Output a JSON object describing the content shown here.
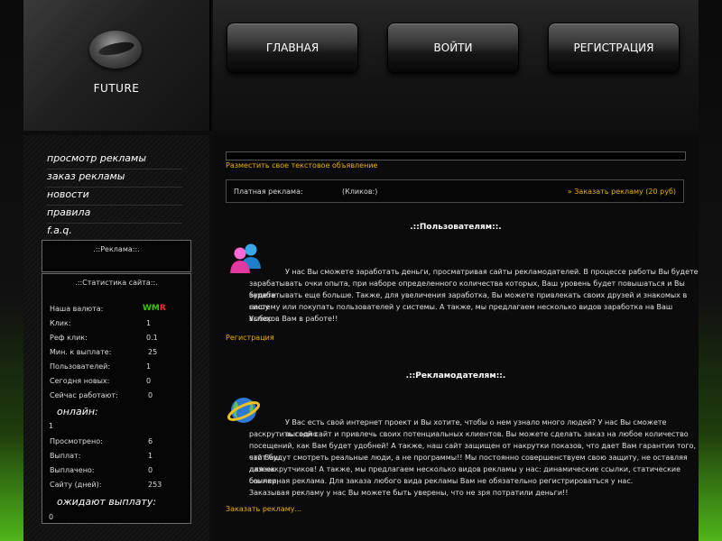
{
  "logo": {
    "text": "FUTURE"
  },
  "nav": [
    {
      "label": "ГЛАВНАЯ"
    },
    {
      "label": "ВОЙТИ"
    },
    {
      "label": "РЕГИСТРАЦИЯ"
    }
  ],
  "sidebar": {
    "menu": [
      {
        "label": "просмотр рекламы"
      },
      {
        "label": "заказ рекламы"
      },
      {
        "label": "новости"
      },
      {
        "label": "правила"
      },
      {
        "label": "f.a.q."
      }
    ],
    "ads_box": {
      "title": ".::Реклама::."
    },
    "stats": {
      "title": ".::Статистика сайта::.",
      "currency_label": "Наша валюта:",
      "currency_wm": "WM",
      "currency_r": "R",
      "rows": [
        {
          "label": "Клик:",
          "value": "1"
        },
        {
          "label": "Реф клик:",
          "value": "0.1"
        },
        {
          "label": "Мин. к выплате:",
          "value": "25"
        },
        {
          "label": "Пользователей:",
          "value": "1"
        },
        {
          "label": "Сегодня новых:",
          "value": "0"
        },
        {
          "label": "Сейчас работают:",
          "value": "0"
        }
      ],
      "online_label": "онлайн:",
      "online_value": "1",
      "rows2": [
        {
          "label": "Просмотрено:",
          "value": "6"
        },
        {
          "label": "Выплат:",
          "value": "1"
        },
        {
          "label": "Выплачено:",
          "value": "0"
        },
        {
          "label": "Сайту (дней):",
          "value": "253"
        }
      ],
      "waiting_label": "ожидают выплату:",
      "waiting_value": "0"
    }
  },
  "main": {
    "text_ad_link": "Разместить свое текстовое объявление",
    "paid_ads": {
      "label": "Платная реклама:",
      "clicks": "(Кликов:)",
      "order_link": "» Заказать рекламу (20 руб)"
    },
    "users": {
      "heading": ".::Пользователям::.",
      "lines": [
        "У нас Вы сможете заработать деньги, просматривая сайты рекламодателей. В процессе работы Вы будете",
        "зарабатывать очки опыта, при наборе определенного количества которых, Ваш уровень будет повышаться и Вы будете",
        "зарабатывать еще больше. Также, для увеличения заработка, Вы можете привлекать своих друзей и знакомых в нашу",
        "систему или покупать пользователей у системы. А также, мы предлагаем несколько видов заработка на Ваш  выбор.",
        "Успехов Вам в работе!!"
      ],
      "link": "Регистрация"
    },
    "advertisers": {
      "heading": ".::Рекламодателям::.",
      "lines": [
        "У Вас есть свой интернет проект и Вы хотите, чтобы о нем узнало много людей? У нас Вы сможете выгодно",
        "раскрутить свой сайт и привлечь своих потенциальных клиентов. Вы можете сделать заказ на любое количество",
        "посещений, как Вам будет удобней! А также, наш сайт защищен от накрутки показов, что дает Вам гарантии того, что Ваш",
        "сайт будут смотреть реальные люди, а не программы!! Мы постоянно совершенствуем свою защиту, не оставляя лазеек",
        "для накрутчиков! А также, мы предлагаем несколько видов рекламы у нас: динамические ссылки, статические ссылки,",
        "баннерная реклама. Для заказа любого вида рекламы Вам не обязательно регистрироваться у нас.",
        "Заказывая рекламу у нас Вы можете быть уверены, что не зря потратили деньги!!"
      ],
      "link": "Заказать рекламу..."
    }
  },
  "colors": {
    "accent": "#e8b000",
    "wm_green": "#33cc00",
    "wm_red": "#ff2a2a",
    "bg_green": "#4fb51a"
  }
}
